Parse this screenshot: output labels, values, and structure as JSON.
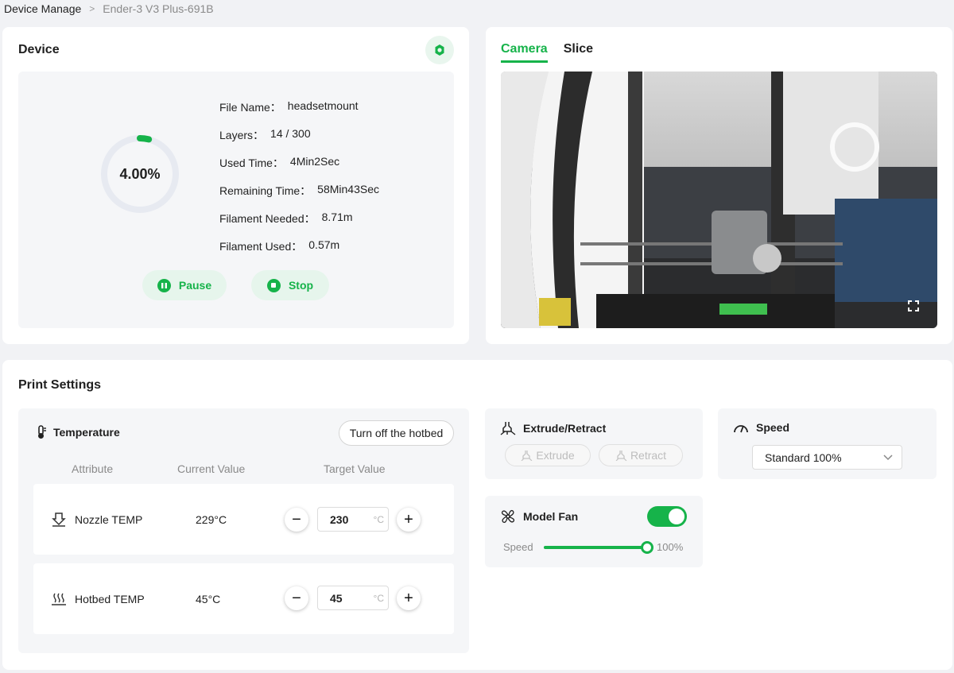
{
  "breadcrumb": {
    "root": "Device Manage",
    "separator": ">",
    "current": "Ender-3 V3 Plus-691B"
  },
  "device": {
    "title": "Device",
    "progress_text": "4.00%",
    "progress_fraction": 0.04,
    "info": [
      {
        "label": "File Name：",
        "value": "headsetmount"
      },
      {
        "label": "Layers：",
        "value": "14 / 300"
      },
      {
        "label": "Used Time：",
        "value": "4Min2Sec"
      },
      {
        "label": "Remaining Time：",
        "value": "58Min43Sec"
      },
      {
        "label": "Filament Needed：",
        "value": "8.71m"
      },
      {
        "label": "Filament Used：",
        "value": "0.57m"
      }
    ],
    "pause_label": "Pause",
    "stop_label": "Stop"
  },
  "camera": {
    "tabs": [
      {
        "label": "Camera",
        "active": true
      },
      {
        "label": "Slice",
        "active": false
      }
    ],
    "fullscreen_icon": "fullscreen-icon"
  },
  "print_settings": {
    "title": "Print Settings",
    "temperature": {
      "title": "Temperature",
      "hotbed_button": "Turn off the hotbed",
      "columns": {
        "attribute": "Attribute",
        "current": "Current Value",
        "target": "Target Value"
      },
      "rows": [
        {
          "name": "Nozzle TEMP",
          "current": "229°C",
          "target": "230",
          "unit": "°C",
          "icon": "nozzle-icon"
        },
        {
          "name": "Hotbed TEMP",
          "current": "45°C",
          "target": "45",
          "unit": "°C",
          "icon": "hotbed-icon"
        }
      ],
      "minus": "−",
      "plus": "+"
    },
    "extrude": {
      "title": "Extrude/Retract",
      "extrude_label": "Extrude",
      "retract_label": "Retract"
    },
    "speed": {
      "title": "Speed",
      "selected": "Standard 100%"
    },
    "fan": {
      "title": "Model Fan",
      "enabled": true,
      "speed_label": "Speed",
      "speed_value": "100%",
      "speed_fraction": 1.0
    }
  },
  "colors": {
    "accent": "#16b34a",
    "accent_light": "#e6f5ec",
    "panel": "#f5f6f8",
    "background": "#f1f2f5"
  }
}
